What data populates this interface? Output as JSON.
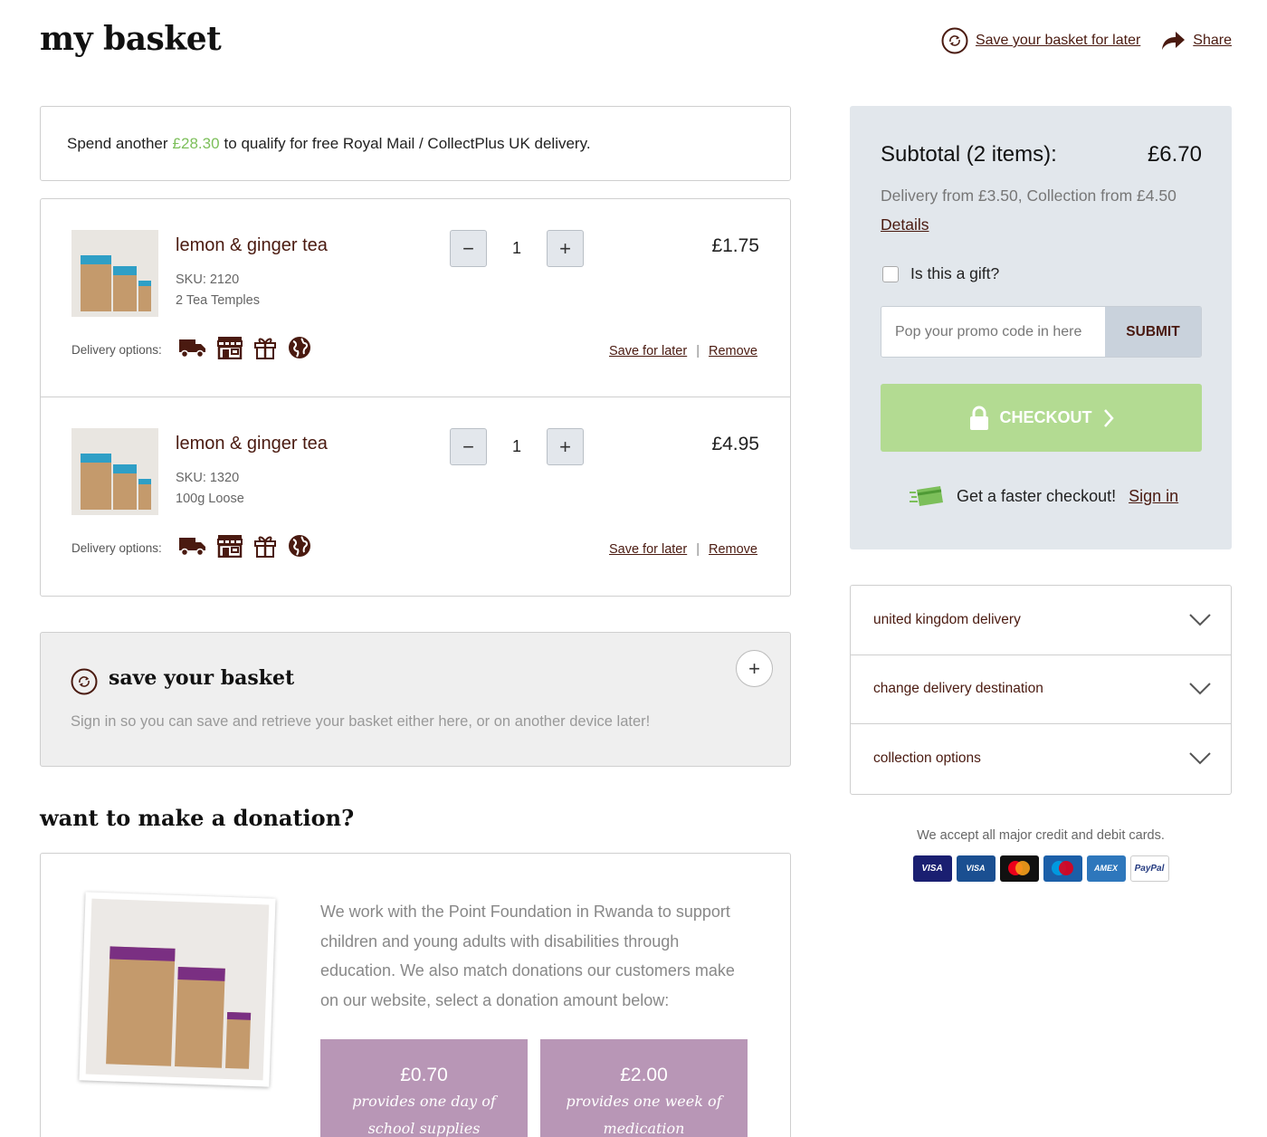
{
  "header": {
    "title": "my basket",
    "save_link": "Save your basket for later",
    "share_link": "Share"
  },
  "promo_banner": {
    "prefix": "Spend another",
    "amount": "£28.30",
    "suffix": "to qualify for free Royal Mail / CollectPlus UK delivery."
  },
  "items": [
    {
      "name": "lemon & ginger tea",
      "sku": "SKU: 2120",
      "variant": "2 Tea Temples",
      "qty": "1",
      "price": "£1.75",
      "delivery_label": "Delivery options:",
      "save_label": "Save for later",
      "remove_label": "Remove",
      "separator": "|"
    },
    {
      "name": "lemon & ginger tea",
      "sku": "SKU: 1320",
      "variant": "100g Loose",
      "qty": "1",
      "price": "£4.95",
      "delivery_label": "Delivery options:",
      "save_label": "Save for later",
      "remove_label": "Remove",
      "separator": "|"
    }
  ],
  "qty_buttons": {
    "minus": "−",
    "plus": "+"
  },
  "delivery_icons": [
    "truck-icon",
    "store-icon",
    "gift-icon",
    "globe-icon"
  ],
  "save_basket": {
    "title": "save your basket",
    "text": "Sign in so you can save and retrieve your basket either here, or on another device later!",
    "expand": "+"
  },
  "donation": {
    "title": "want to make a donation?",
    "text": "We work with the Point Foundation in Rwanda to support children and young adults with disabilities through education. We also match donations our customers make on our website, select a donation amount below:",
    "options": [
      {
        "value": "£0.70",
        "line1": "provides one day of",
        "line2": "school supplies"
      },
      {
        "value": "£2.00",
        "line1": "provides one week of",
        "line2": "medication"
      }
    ]
  },
  "summary": {
    "subtotal_label": "Subtotal (2 items):",
    "subtotal_value": "£6.70",
    "delivery_from": "Delivery from £3.50, Collection from £4.50",
    "details_link": "Details",
    "gift_label": "Is this a gift?",
    "promo_placeholder": "Pop your promo code in here",
    "submit_label": "SUBMIT",
    "checkout_label": "CHECKOUT",
    "faster_text": "Get a faster checkout!",
    "sign_in_link": "Sign in"
  },
  "accordion": [
    {
      "label": "united kingdom delivery"
    },
    {
      "label": "change delivery destination"
    },
    {
      "label": "collection options"
    }
  ],
  "payments": {
    "text": "We accept all major credit and debit cards.",
    "cards": [
      "VISA",
      "VISA",
      "",
      "",
      "AMEX",
      "PayPal"
    ]
  },
  "colors": {
    "brand": "#4a1a10",
    "accent_green": "#7cbf5a",
    "checkout_green": "#b3db92",
    "donation_purple": "#b896b6",
    "summary_bg": "#e2e7ec"
  }
}
